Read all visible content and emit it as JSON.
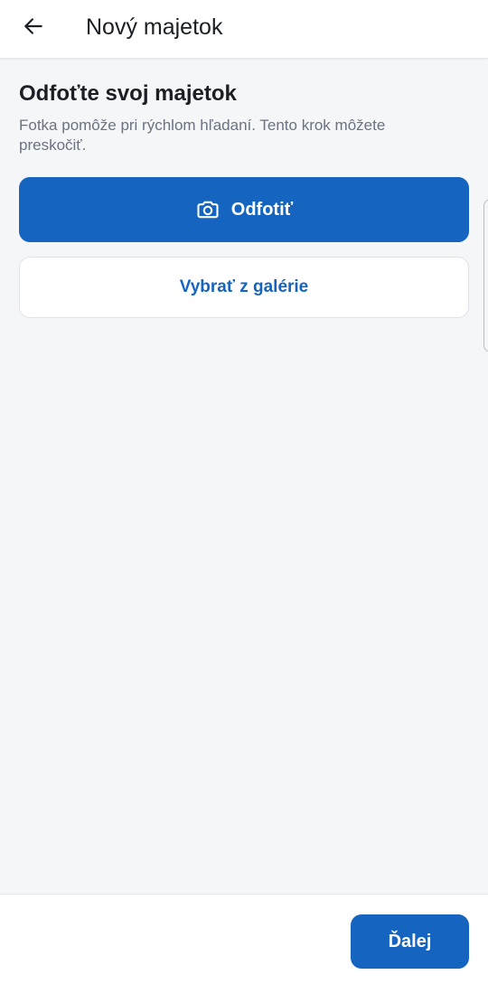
{
  "header": {
    "title": "Nový majetok",
    "back_icon": "arrow-left-icon"
  },
  "main": {
    "heading": "Odfoťte svoj majetok",
    "subtext": "Fotka pomôže pri rýchlom hľadaní. Tento krok môžete preskočiť.",
    "take_photo_label": "Odfotiť",
    "take_photo_icon": "camera-icon",
    "gallery_label": "Vybrať z galérie"
  },
  "footer": {
    "next_label": "Ďalej"
  },
  "colors": {
    "accent": "#1565c0",
    "background": "#f4f6f8",
    "surface": "#ffffff",
    "text": "#1b1f24",
    "muted_text": "#6b7280"
  }
}
